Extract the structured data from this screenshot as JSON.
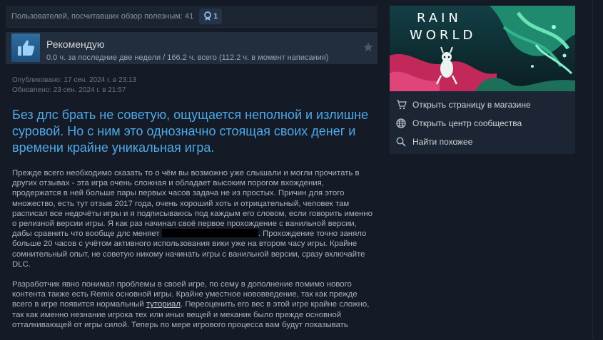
{
  "helpful": {
    "text": "Пользователей, посчитавших обзор полезным: 41",
    "award_count": "1"
  },
  "review": {
    "verdict": "Рекомендую",
    "hours": "0.0 ч. за последние две недели / 166.2 ч. всего (112.2 ч. в момент написания)",
    "published": "Опубликовано: 17 сен. 2024 г. в 23:13",
    "updated": "Обновлено: 23 сен. 2024 г. в 21:57",
    "title": "Без длс брать не советую, ощущается неполной и излишне суровой. Но с ним это однозначно стоящая своих денег и времени крайне уникальная игра.",
    "p1_a": "Прежде всего необходимо сказать то о чём вы возможно уже слышали и могли прочитать в других отзывах - эта игра очень сложная и обладает высоким порогом вхождения, продержатся в ней больше пары первых часов задача не из простых. Причин для этого множество, есть тут отзыв 2017 года, очень хороший хоть и отрицательный, человек там расписал все недочёты игры и я подписываюсь под каждым его словом, если говорить именно о релизной версии игры. Я как раз начинал своё первое прохождение с ванильной версии, дабы сравнить что вообще длс меняет ",
    "p1_b": ". Прохождение точно заняло больше 20 часов с учётом активного использования вики уже на втором часу игры. Крайне сомнительный опыт, не советую никому начинать игры с ванильной версии, сразу включайте DLC.",
    "p2_a": "Разработчик явно понимал проблемы в своей игре, по сему в дополнение помимо нового контента также есть Remix основной игры. Крайне уместное нововведение, так как прежде всего в игре появится нормальный ",
    "p2_link": "туториал",
    "p2_b": ". Переоценить его вес в этой игре крайне сложно, так как именно незнание игрока тех или иных вещей и механик было прежде основной отталкивающей от игры силой. Теперь по мере игрового процесса вам будут показывать"
  },
  "game": {
    "logo_line1": "RAIN",
    "logo_line2": "WORLD",
    "links": [
      {
        "label": "Открыть страницу в магазине",
        "icon": "cart-icon"
      },
      {
        "label": "Открыть центр сообщества",
        "icon": "globe-icon"
      },
      {
        "label": "Найти похожее",
        "icon": "search-icon"
      }
    ]
  },
  "colors": {
    "background": "#141b26",
    "title_blue": "#4fa8e8",
    "text": "#acb2b8"
  }
}
